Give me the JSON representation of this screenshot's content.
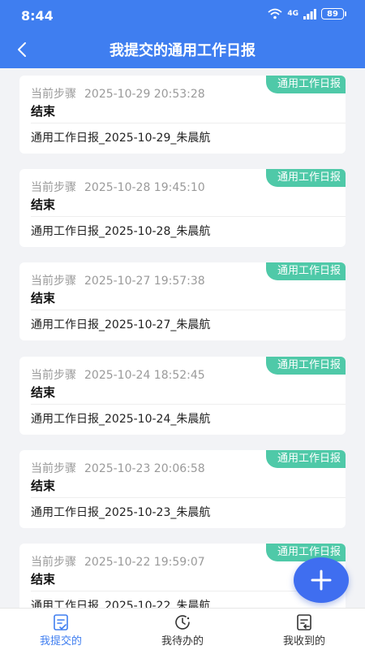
{
  "status_bar": {
    "time": "8:44",
    "network": "4G",
    "battery": "89"
  },
  "header": {
    "title": "我提交的通用工作日报"
  },
  "list": {
    "items": [
      {
        "tag": "通用工作日报",
        "step_label": "当前步骤",
        "timestamp": "2025-10-29 20:53:28",
        "status": "结束",
        "name": "通用工作日报_2025-10-29_朱晨航"
      },
      {
        "tag": "通用工作日报",
        "step_label": "当前步骤",
        "timestamp": "2025-10-28 19:45:10",
        "status": "结束",
        "name": "通用工作日报_2025-10-28_朱晨航"
      },
      {
        "tag": "通用工作日报",
        "step_label": "当前步骤",
        "timestamp": "2025-10-27 19:57:38",
        "status": "结束",
        "name": "通用工作日报_2025-10-27_朱晨航"
      },
      {
        "tag": "通用工作日报",
        "step_label": "当前步骤",
        "timestamp": "2025-10-24 18:52:45",
        "status": "结束",
        "name": "通用工作日报_2025-10-24_朱晨航"
      },
      {
        "tag": "通用工作日报",
        "step_label": "当前步骤",
        "timestamp": "2025-10-23 20:06:58",
        "status": "结束",
        "name": "通用工作日报_2025-10-23_朱晨航"
      },
      {
        "tag": "通用工作日报",
        "step_label": "当前步骤",
        "timestamp": "2025-10-22 19:59:07",
        "status": "结束",
        "name": "通用工作日报_2025-10-22_朱晨航"
      }
    ]
  },
  "bottom_nav": {
    "items": [
      {
        "label": "我提交的",
        "icon": "submitted-doc-icon",
        "active": true
      },
      {
        "label": "我待办的",
        "icon": "clock-pending-icon",
        "active": false
      },
      {
        "label": "我收到的",
        "icon": "received-doc-icon",
        "active": false
      }
    ]
  },
  "colors": {
    "header": "#3f7ef0",
    "tag": "#4fc9a8",
    "fab": "#3f6ef0",
    "active_nav": "#3f7ef0"
  }
}
